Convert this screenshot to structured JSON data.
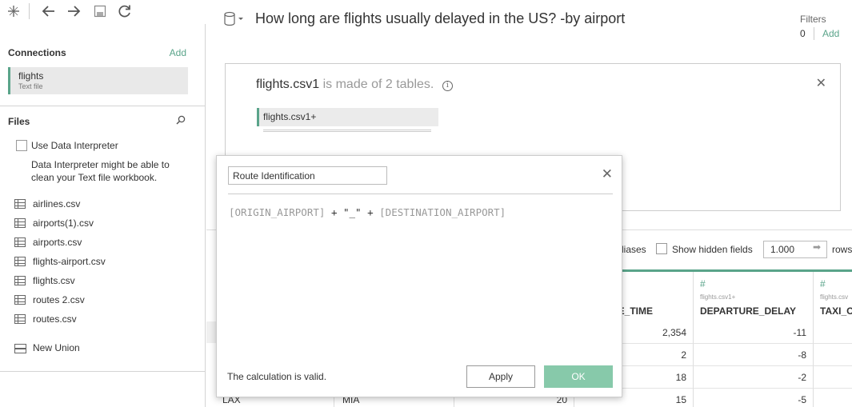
{
  "toolbar": {
    "icons": [
      "tableau-logo-icon",
      "back-arrow-icon",
      "forward-arrow-icon",
      "save-icon",
      "refresh-icon"
    ]
  },
  "sidebar": {
    "connections_title": "Connections",
    "connections_add": "Add",
    "connection": {
      "name": "flights",
      "type": "Text file"
    },
    "files_title": "Files",
    "use_interpreter": "Use Data Interpreter",
    "interpreter_hint": "Data Interpreter might be able to clean your Text file workbook.",
    "files": [
      "airlines.csv",
      "airports(1).csv",
      "airports.csv",
      "flights-airport.csv",
      "flights.csv",
      "routes 2.csv",
      "routes.csv"
    ],
    "new_union": "New Union"
  },
  "header": {
    "title": "How long are flights usually delayed in the US? -by airport",
    "filters_label": "Filters",
    "filters_count": "0",
    "filters_add": "Add"
  },
  "canvas": {
    "file_name": "flights.csv1",
    "made_of": "is made of 2 tables.",
    "table_pill": "flights.csv1+"
  },
  "grid": {
    "aliases_label": "liases",
    "show_hidden_label": "Show hidden fields",
    "rows_value": "1.000",
    "rows_label": "rows",
    "columns": [
      {
        "source": "",
        "name": "RE_TIME"
      },
      {
        "source": "flights.csv1+",
        "name": "DEPARTURE_DELAY"
      },
      {
        "source": "flights.csv",
        "name": "TAXI_O"
      }
    ],
    "rows": [
      {
        "origin": "",
        "dest": "",
        "n": "",
        "time": "2,354",
        "delay": "-11"
      },
      {
        "origin": "",
        "dest": "",
        "n": "",
        "time": "2",
        "delay": "-8"
      },
      {
        "origin": "",
        "dest": "",
        "n": "",
        "time": "18",
        "delay": "-2"
      },
      {
        "origin": "LAX",
        "dest": "MIA",
        "n": "20",
        "time": "15",
        "delay": "-5"
      }
    ]
  },
  "dialog": {
    "calc_name": "Route Identification",
    "formula": {
      "field1": "[ORIGIN_AIRPORT]",
      "op1": " + ",
      "literal": "\"_\"",
      "op2": " + ",
      "field2": "[DESTINATION_AIRPORT]"
    },
    "status": "The calculation is valid.",
    "apply_label": "Apply",
    "ok_label": "OK"
  },
  "colors": {
    "accent": "#5aa48a",
    "ok_button": "#87c9aa"
  }
}
